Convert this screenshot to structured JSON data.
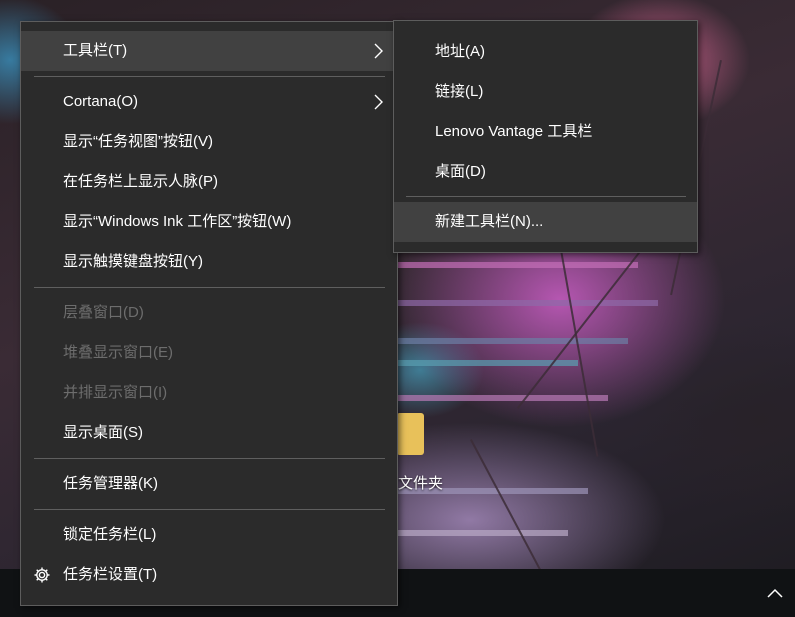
{
  "colors": {
    "menu_background": "#2b2b2b",
    "menu_highlight": "#414141",
    "menu_text": "#ffffff",
    "menu_disabled_text": "#6d6d6d",
    "separator": "#5f5f5f",
    "taskbar": "#101214"
  },
  "desktop": {
    "folder_label": "文件夹",
    "tray_icon": "chevron-up-icon"
  },
  "context_menu": {
    "items": [
      {
        "label": "工具栏(T)",
        "has_submenu": true,
        "highlighted": true
      },
      {
        "label": "Cortana(O)",
        "has_submenu": true
      },
      {
        "label": "显示“任务视图”按钮(V)"
      },
      {
        "label": "在任务栏上显示人脉(P)"
      },
      {
        "label": "显示“Windows Ink 工作区”按钮(W)"
      },
      {
        "label": "显示触摸键盘按钮(Y)"
      },
      {
        "label": "层叠窗口(D)",
        "disabled": true
      },
      {
        "label": "堆叠显示窗口(E)",
        "disabled": true
      },
      {
        "label": "并排显示窗口(I)",
        "disabled": true
      },
      {
        "label": "显示桌面(S)"
      },
      {
        "label": "任务管理器(K)"
      },
      {
        "label": "锁定任务栏(L)"
      },
      {
        "label": "任务栏设置(T)",
        "icon": "gear-icon"
      }
    ]
  },
  "toolbar_submenu": {
    "items": [
      {
        "label": "地址(A)"
      },
      {
        "label": "链接(L)"
      },
      {
        "label": "Lenovo Vantage 工具栏"
      },
      {
        "label": "桌面(D)"
      },
      {
        "label": "新建工具栏(N)...",
        "highlighted": true
      }
    ]
  }
}
